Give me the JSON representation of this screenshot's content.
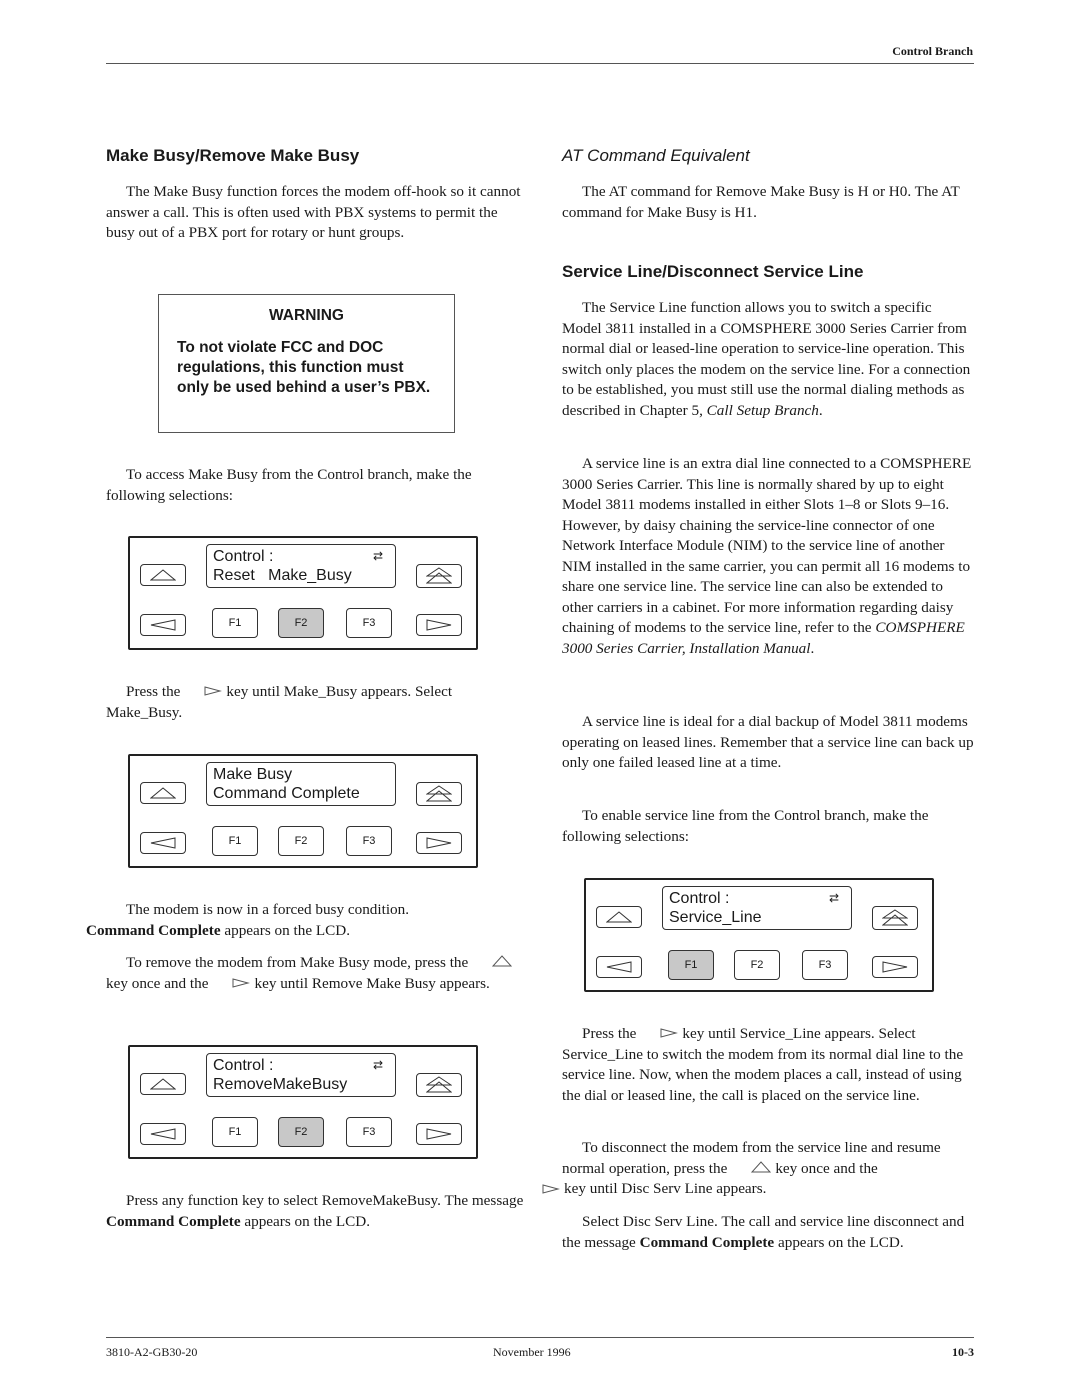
{
  "header": {
    "section": "Control Branch"
  },
  "left": {
    "heading": "Make Busy/Remove Make Busy",
    "intro": "The Make Busy function forces the modem off-hook so it cannot answer a call. This is often used with PBX systems to permit the busy out of a PBX port for rotary or hunt groups.",
    "warning": {
      "title": "WARNING",
      "text": "To not violate FCC and DOC regulations, this function must only be used behind a user’s PBX."
    },
    "access_text": "To access Make Busy from the Control branch, make the following selections:",
    "press1_pre": "Press the",
    "press1_post": "key until Make_Busy appears. Select Make_Busy.",
    "forced_busy": "The modem is now in a forced busy condition.",
    "cmd_complete_bold": "Command Complete",
    "cmd_complete_rest": " appears on the LCD.",
    "remove_a": "To remove the modem from Make Busy mode, press the",
    "remove_b": "key once and the",
    "remove_c": "key until Remove Make Busy appears.",
    "final_a": "Press any function key to select RemoveMakeBusy. The message ",
    "final_bold": "Command Complete",
    "final_c": " appears on the LCD."
  },
  "panels": [
    {
      "line1": "Control :",
      "line2": "Reset   Make_Busy",
      "show_arrows": true,
      "pressed": "F2"
    },
    {
      "line1": "Make Busy",
      "line2": "Command Complete",
      "show_arrows": false,
      "pressed": ""
    },
    {
      "line1": "Control :",
      "line2": "RemoveMakeBusy",
      "show_arrows": true,
      "pressed": "F2"
    },
    {
      "line1": "Control :",
      "line2": "Service_Line",
      "show_arrows": true,
      "pressed": "F1"
    }
  ],
  "keys": {
    "f1": "F1",
    "f2": "F2",
    "f3": "F3",
    "arrows_glyph": "⇄"
  },
  "right": {
    "at_heading": "AT Command Equivalent",
    "at_text": "The AT command for Remove Make Busy is H or H0. The AT command for Make Busy is H1.",
    "sl_heading": "Service Line/Disconnect Service Line",
    "sl_p1_a": "The Service Line function allows you to switch a specific Model 3811 installed in a COMSPHERE 3000 Series Carrier from normal dial or leased-line operation to service-line operation. This switch only places the modem on the service line. For a connection to be established, you must still use the normal dialing methods as described in Chapter 5, ",
    "sl_p1_ital": "Call Setup Branch",
    "sl_p1_end": ".",
    "sl_p2_a": "A service line is an extra dial line connected to a COMSPHERE 3000 Series Carrier. This line is normally shared by up to eight Model 3811 modems installed in either Slots 1–8 or Slots 9–16. However, by daisy chaining the service-line connector of one Network Interface Module (NIM) to the service line of another NIM installed in the same carrier, you can permit all 16 modems to share one service line. The service line can also be extended to other carriers in a cabinet. For more information regarding daisy chaining of modems to the service line, refer to the ",
    "sl_p2_ital": "COMSPHERE 3000 Series Carrier, Installation Manual",
    "sl_p2_end": ".",
    "sl_p3": "A service line is ideal for a dial backup of Model 3811 modems operating on leased lines. Remember that a service line can back up only one failed leased line at a time.",
    "sl_p4": "To enable service line from the Control branch, make the following selections:",
    "sl_p5_a": "Press the",
    "sl_p5_b": "key until Service_Line appears. Select Service_Line to switch the modem from its normal dial line to the service line. Now, when the modem places a call, instead of using the dial or leased line, the call is placed on the service line.",
    "sl_p6_a": "To disconnect the modem from the service line and resume normal operation, press the",
    "sl_p6_b": "key once and the",
    "sl_p6_c": "key until Disc Serv Line appears.",
    "sl_p7_a": "Select Disc Serv Line. The call and service line disconnect and the message ",
    "sl_p7_bold": "Command Complete",
    "sl_p7_c": " appears on the LCD."
  },
  "footer": {
    "doc_number": "3810-A2-GB30-20",
    "date": "November 1996",
    "page": "10-3"
  }
}
